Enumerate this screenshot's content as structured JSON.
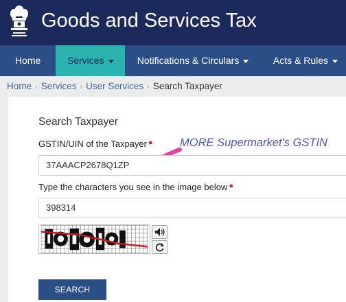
{
  "header": {
    "title": "Goods and Services Tax"
  },
  "nav": {
    "home": "Home",
    "services": "Services",
    "notifications": "Notifications & Circulars",
    "acts": "Acts & Rules"
  },
  "breadcrumb": {
    "home": "Home",
    "services": "Services",
    "user_services": "User Services",
    "current": "Search Taxpayer"
  },
  "form": {
    "title": "Search Taxpayer",
    "gstin_label": "GSTIN/UIN of the Taxpayer",
    "gstin_value": "37AAACP2678Q1ZP",
    "captcha_label": "Type the characters you see in the image below",
    "captcha_value": "398314",
    "search_button": "SEARCH"
  },
  "annotation": "MORE Supermarket's GSTIN",
  "colors": {
    "header_bg": "#1b2a5a",
    "nav_bg": "#2c4e86",
    "nav_active": "#2bb3b0",
    "annotation": "#4c56b8",
    "arrow": "#e33f9c"
  }
}
